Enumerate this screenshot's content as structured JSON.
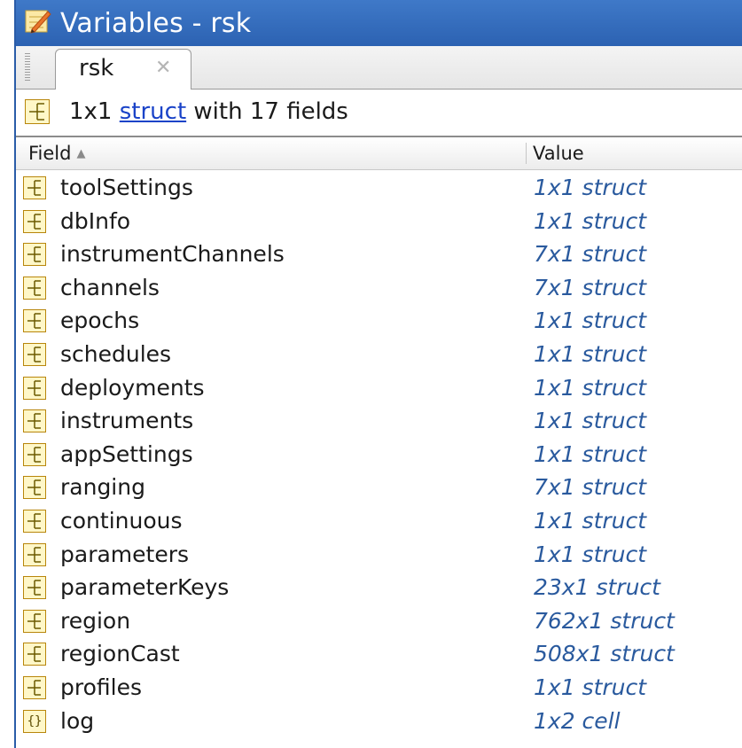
{
  "window": {
    "title": "Variables - rsk",
    "icon": "variables-editor-icon"
  },
  "tabs": [
    {
      "label": "rsk",
      "close_icon": "close-icon"
    }
  ],
  "info": {
    "prefix": "1x1",
    "link": "struct",
    "suffix": "with 17 fields"
  },
  "columns": {
    "field": "Field",
    "value": "Value",
    "sort_icon": "sort-ascending-icon"
  },
  "rows": [
    {
      "name": "toolSettings",
      "value": "1x1 struct",
      "icon": "struct-icon"
    },
    {
      "name": "dbInfo",
      "value": "1x1 struct",
      "icon": "struct-icon"
    },
    {
      "name": "instrumentChannels",
      "value": "7x1 struct",
      "icon": "struct-icon"
    },
    {
      "name": "channels",
      "value": "7x1 struct",
      "icon": "struct-icon"
    },
    {
      "name": "epochs",
      "value": "1x1 struct",
      "icon": "struct-icon"
    },
    {
      "name": "schedules",
      "value": "1x1 struct",
      "icon": "struct-icon"
    },
    {
      "name": "deployments",
      "value": "1x1 struct",
      "icon": "struct-icon"
    },
    {
      "name": "instruments",
      "value": "1x1 struct",
      "icon": "struct-icon"
    },
    {
      "name": "appSettings",
      "value": "1x1 struct",
      "icon": "struct-icon"
    },
    {
      "name": "ranging",
      "value": "7x1 struct",
      "icon": "struct-icon"
    },
    {
      "name": "continuous",
      "value": "1x1 struct",
      "icon": "struct-icon"
    },
    {
      "name": "parameters",
      "value": "1x1 struct",
      "icon": "struct-icon"
    },
    {
      "name": "parameterKeys",
      "value": "23x1 struct",
      "icon": "struct-icon"
    },
    {
      "name": "region",
      "value": "762x1 struct",
      "icon": "struct-icon"
    },
    {
      "name": "regionCast",
      "value": "508x1 struct",
      "icon": "struct-icon"
    },
    {
      "name": "profiles",
      "value": "1x1 struct",
      "icon": "struct-icon"
    },
    {
      "name": "log",
      "value": "1x2 cell",
      "icon": "cell-icon"
    }
  ],
  "colors": {
    "titlebar": "#2c62b2",
    "value_text": "#2a5a9e",
    "link": "#1a43c8",
    "struct_icon_border": "#b8860b",
    "struct_icon_fill": "#fff7c8"
  }
}
